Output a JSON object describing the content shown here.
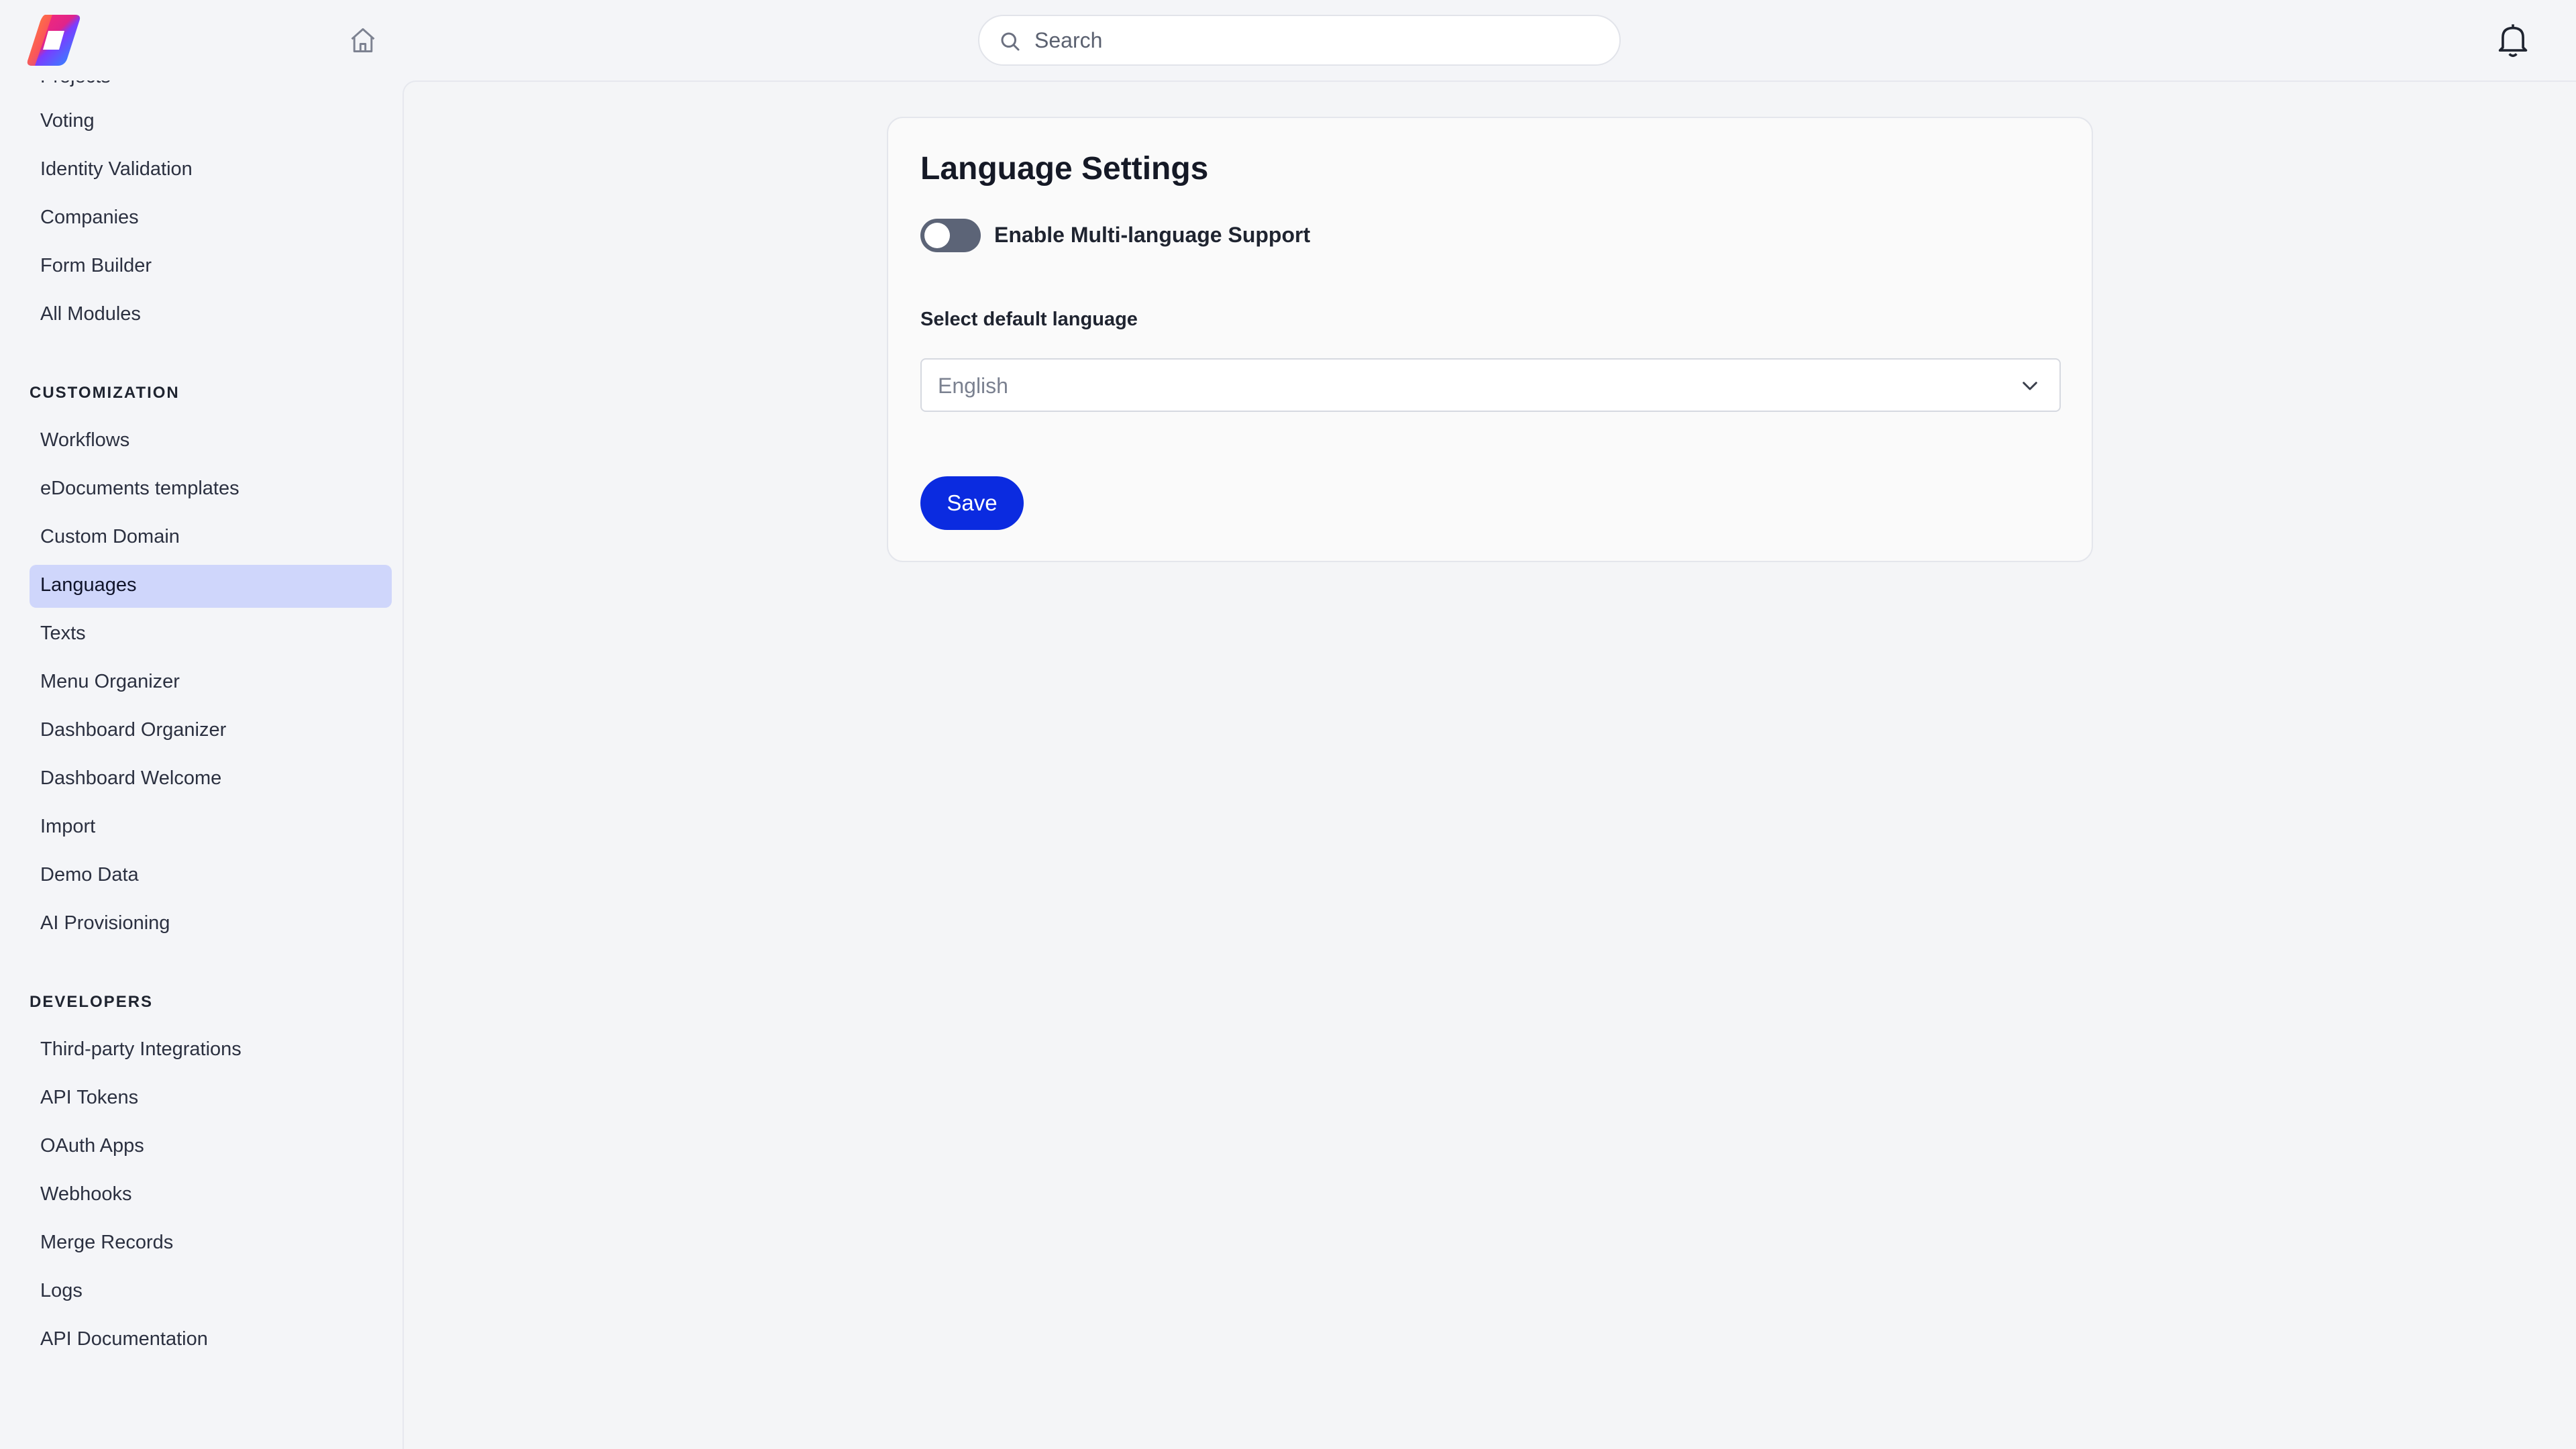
{
  "topbar": {
    "logo_icon": "app-logo",
    "home_icon": "home-icon",
    "search": {
      "placeholder": "Search",
      "value": ""
    },
    "bell_icon": "bell-icon"
  },
  "sidebar": {
    "partial_item": "Projects",
    "top_items": [
      {
        "label": "Voting"
      },
      {
        "label": "Identity Validation"
      },
      {
        "label": "Companies"
      },
      {
        "label": "Form Builder"
      },
      {
        "label": "All Modules"
      }
    ],
    "customization": {
      "heading": "CUSTOMIZATION",
      "items": [
        {
          "label": "Workflows"
        },
        {
          "label": "eDocuments templates"
        },
        {
          "label": "Custom Domain"
        },
        {
          "label": "Languages",
          "active": true
        },
        {
          "label": "Texts"
        },
        {
          "label": "Menu Organizer"
        },
        {
          "label": "Dashboard Organizer"
        },
        {
          "label": "Dashboard Welcome"
        },
        {
          "label": "Import"
        },
        {
          "label": "Demo Data"
        },
        {
          "label": "AI Provisioning"
        }
      ]
    },
    "developers": {
      "heading": "DEVELOPERS",
      "items": [
        {
          "label": "Third-party Integrations"
        },
        {
          "label": "API Tokens"
        },
        {
          "label": "OAuth Apps"
        },
        {
          "label": "Webhooks"
        },
        {
          "label": "Merge Records"
        },
        {
          "label": "Logs"
        },
        {
          "label": "API Documentation"
        }
      ]
    }
  },
  "main": {
    "card": {
      "title": "Language Settings",
      "toggle": {
        "label": "Enable Multi-language Support",
        "enabled": false
      },
      "default_language": {
        "label": "Select default language",
        "selected": "English"
      },
      "save_label": "Save"
    }
  },
  "colors": {
    "accent": "#0b2be0",
    "active_nav_bg": "#cfd6fb",
    "toggle_off": "#5c6477"
  }
}
